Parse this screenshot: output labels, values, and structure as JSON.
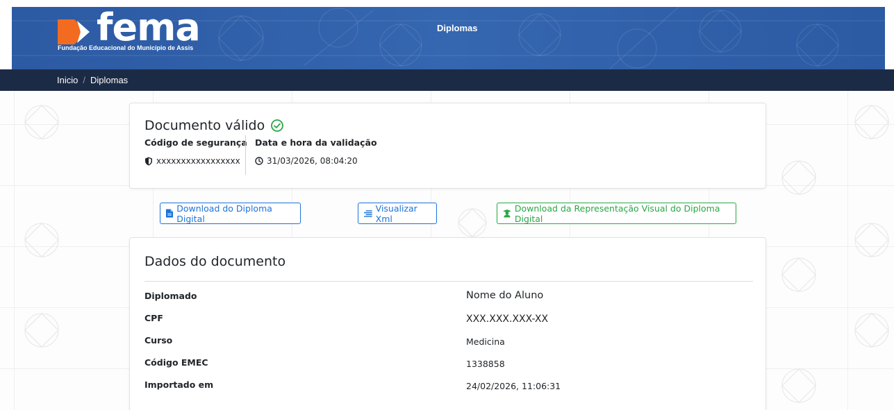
{
  "header": {
    "logo_text": "fema",
    "logo_subtitle": "Fundação Educacional do Município de Assis",
    "title": "Diplomas"
  },
  "breadcrumb": {
    "items": [
      "Inicio",
      "Diplomas"
    ],
    "separator": "/"
  },
  "status": {
    "title": "Documento válido",
    "security_code_label": "Código de segurança",
    "security_code_value": "xxxxxxxxxxxxxxxxx",
    "validation_label": "Data e hora da validação",
    "validation_value": "31/03/2026, 08:04:20"
  },
  "actions": {
    "download_diploma": "Download do Diploma Digital",
    "view_xml": "Visualizar Xml",
    "download_visual": "Download da Representação Visual do Diploma Digital"
  },
  "document": {
    "title": "Dados do documento",
    "rows": [
      {
        "label": "Diplomado",
        "value": "Nome do Aluno"
      },
      {
        "label": "CPF",
        "value": "XXX.XXX.XXX-XX"
      },
      {
        "label": "Curso",
        "value": "Medicina"
      },
      {
        "label": "Código EMEC",
        "value": "1338858"
      },
      {
        "label": "Importado em",
        "value": "24/02/2026, 11:06:31"
      }
    ]
  },
  "colors": {
    "header_blue": "#2f5ea8",
    "breadcrumb_navy": "#1c2b45",
    "logo_orange": "#f26b21",
    "primary_blue": "#1a73d9",
    "success_green": "#28a745"
  },
  "icons": {
    "valid": "check-circle-icon",
    "security": "shield-icon",
    "time": "clock-icon",
    "file": "file-icon",
    "xml": "list-icon",
    "visual": "graduate-icon"
  }
}
